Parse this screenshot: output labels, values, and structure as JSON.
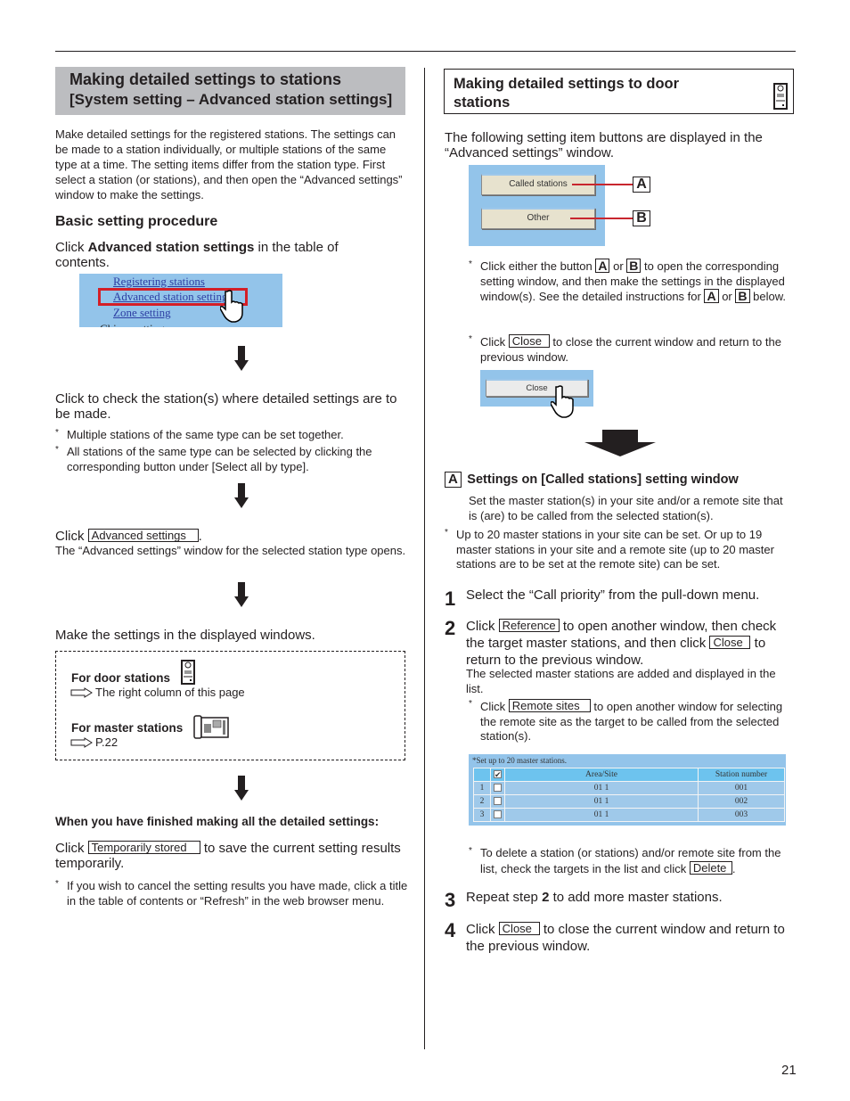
{
  "page_number": "21",
  "left": {
    "header": {
      "title": "Making detailed settings to stations",
      "subtitle": "[System setting – Advanced station settings]"
    },
    "intro": "Make detailed settings for the registered stations. The settings can be made to a station individually, or multiple stations of the same type at a time. The setting items differ from the station type. First select a station (or stations), and then open the “Advanced settings” window to make the settings.",
    "section_title": "Basic setting procedure",
    "step1": {
      "prefix": "Click ",
      "bold": "Advanced station settings",
      "suffix": " in the table of contents."
    },
    "toc_screenshot": {
      "items": [
        "Registering stations",
        "Advanced station settings",
        "Zone setting",
        "Chime setting"
      ],
      "highlighted": "Advanced station settings"
    },
    "step2": {
      "text": "Click to check the station(s) where detailed settings are to be made.",
      "notes": [
        "Multiple stations of the same type can be set together.",
        "All stations of the same type can be selected by clicking the corresponding button under [Select all by type]."
      ]
    },
    "step3": {
      "prefix": "Click ",
      "button": "Advanced settings",
      "suffix": ".",
      "detail": "The “Advanced settings” window for the selected station type opens."
    },
    "step4": {
      "text": "Make the settings in the displayed windows."
    },
    "reference_box": {
      "door_label": "For door stations",
      "door_ref": "The right column of this page",
      "master_label": "For master stations",
      "master_ref": "P.22"
    },
    "finish": {
      "heading": "When you have finished making all the detailed settings:",
      "prefix": "Click ",
      "button": "Temporarily stored",
      "suffix": " to save the current setting results temporarily.",
      "note": "If you wish to cancel the setting results you have made, click a title in the table of contents or “Refresh” in the web browser menu."
    }
  },
  "right": {
    "header": {
      "title_line1": "Making detailed settings to door",
      "title_line2": "stations"
    },
    "intro": "The following setting item buttons are displayed in the “Advanced settings” window.",
    "buttons_screenshot": {
      "buttons": [
        {
          "label": "Called stations",
          "callout": "A"
        },
        {
          "label": "Other",
          "callout": "B"
        }
      ]
    },
    "note1": {
      "t1": "Click either the button ",
      "a": "A",
      "t2": " or ",
      "b": "B",
      "t3": " to open the corresponding setting window, and then make the settings in the displayed window(s). See the detailed instructions for ",
      "t4": " below."
    },
    "note2": {
      "prefix": "Click ",
      "button": "Close",
      "suffix": " to close the current window and return to the previous window."
    },
    "close_screenshot": {
      "label": "Close"
    },
    "section_a": {
      "letter": "A",
      "title": "Settings on [Called stations] setting window",
      "desc": "Set the master station(s) in your site and/or a remote site that is (are) to be called from the selected station(s).",
      "note": "Up to 20 master stations in your site can be set. Or up to 19 master stations in your site and a remote site (up to 20 master stations are to be set at the remote site) can be set."
    },
    "steps": [
      {
        "num": "1",
        "text": "Select the “Call priority” from the pull-down menu."
      },
      {
        "num": "2",
        "prefix": "Click ",
        "button1": "Reference",
        "mid": " to open another window, then check the target master stations, and then click ",
        "button2": "Close",
        "suffix": " to return to the previous window.",
        "detail": "The selected master stations are added and displayed in the list.",
        "note_prefix": "Click ",
        "note_button": "Remote sites",
        "note_suffix": " to open another window for selecting the remote site as the target to be called from the selected station(s)."
      },
      {
        "num": "3",
        "prefix": "Repeat step ",
        "bold": "2",
        "suffix": " to add more master stations."
      },
      {
        "num": "4",
        "prefix": "Click ",
        "button": "Close",
        "suffix": " to close the current window and return to the previous window."
      }
    ],
    "delete_note": {
      "prefix": "To delete a station (or stations) and/or remote site from the list, check the targets in the list and click ",
      "button": "Delete",
      "suffix": "."
    },
    "table_screenshot": {
      "caption": "*Set up to 20 master stations.",
      "columns": [
        "",
        "✔",
        "Area/Site",
        "Station number"
      ],
      "rows": [
        {
          "index": "1",
          "area": "01 1",
          "station": "001"
        },
        {
          "index": "2",
          "area": "01 1",
          "station": "002"
        },
        {
          "index": "3",
          "area": "01 1",
          "station": "003"
        }
      ]
    }
  }
}
